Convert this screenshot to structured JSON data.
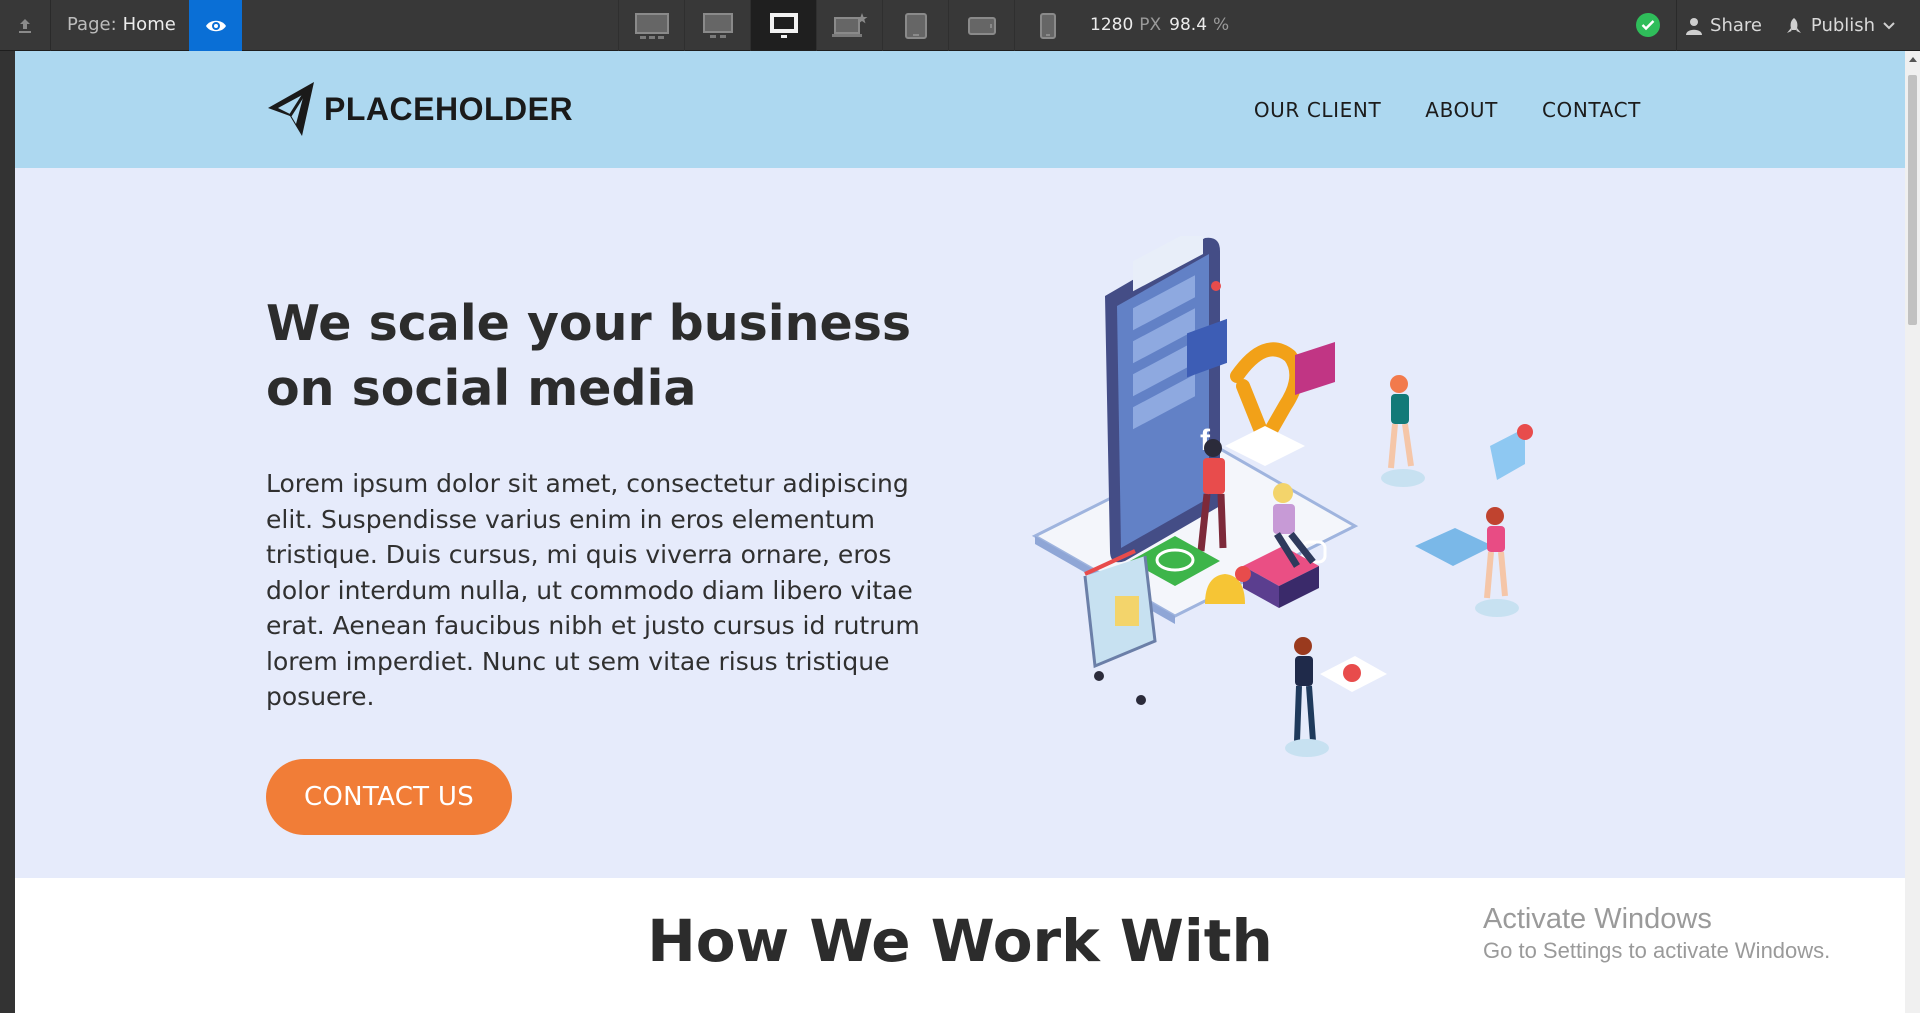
{
  "toolbar": {
    "page_label": "Page:",
    "page_name": "Home",
    "width_value": "1280",
    "width_unit": "PX",
    "zoom_value": "98.4",
    "zoom_unit": "%",
    "share_label": "Share",
    "publish_label": "Publish",
    "devices": [
      "desktop-xl",
      "desktop-large",
      "desktop",
      "laptop-base",
      "tablet",
      "mobile-landscape",
      "mobile-portrait"
    ],
    "active_device": "desktop",
    "status": "published",
    "status_color": "#2fbd5a",
    "preview_color": "#0a6fd6"
  },
  "site": {
    "logo_text": "PLACEHOLDER",
    "nav": [
      "OUR CLIENT",
      "ABOUT",
      "CONTACT"
    ],
    "nav_bg": "#add8f0",
    "hero": {
      "title": "We scale your business on social media",
      "body": "Lorem ipsum dolor sit amet, consectetur adipiscing elit. Suspendisse varius enim in eros elementum tristique. Duis cursus, mi quis viverra ornare, eros dolor interdum nulla, ut commodo diam libero vitae erat. Aenean faucibus nibh et justo cursus id rutrum lorem imperdiet. Nunc ut sem vitae risus tristique posuere.",
      "cta_label": "CONTACT US",
      "cta_color": "#f17d37",
      "bg": "#e6ebfb"
    },
    "section2_title": "How We Work With"
  },
  "os": {
    "activate_title": "Activate Windows",
    "activate_sub": "Go to Settings to activate Windows."
  }
}
